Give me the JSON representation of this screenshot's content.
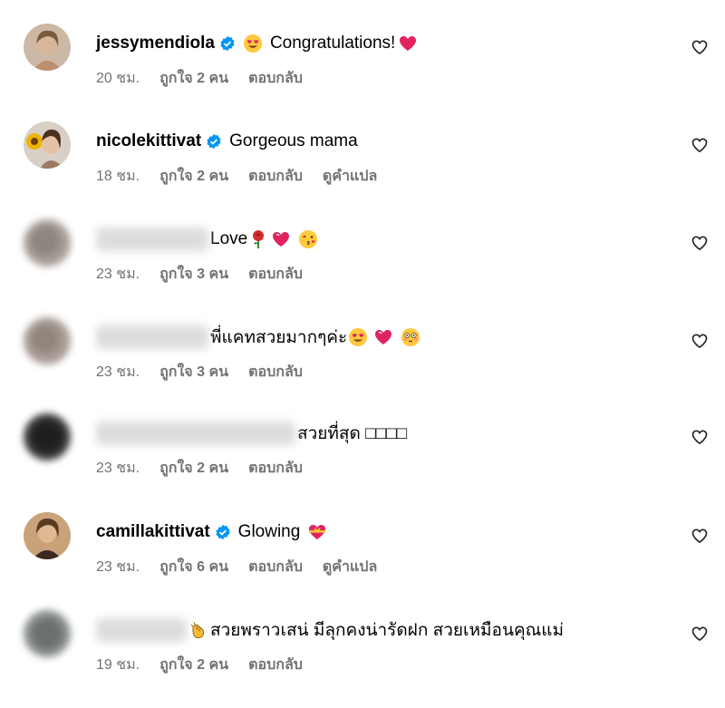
{
  "comments": [
    {
      "username": "jessymendiola",
      "verified": true,
      "text": "Congratulations!",
      "time": "20 ชม.",
      "likes": "ถูกใจ 2 คน",
      "reply": "ตอบกลับ",
      "translate": ""
    },
    {
      "username": "nicolekittivat",
      "verified": true,
      "text": "Gorgeous mama",
      "time": "18 ชม.",
      "likes": "ถูกใจ 2 คน",
      "reply": "ตอบกลับ",
      "translate": "ดูคำแปล"
    },
    {
      "username": "",
      "verified": false,
      "text": "Love",
      "time": "23 ชม.",
      "likes": "ถูกใจ 3 คน",
      "reply": "ตอบกลับ",
      "translate": ""
    },
    {
      "username": "",
      "verified": false,
      "text": "พี่แคทสวยมากๆค่ะ",
      "time": "23 ชม.",
      "likes": "ถูกใจ 3 คน",
      "reply": "ตอบกลับ",
      "translate": ""
    },
    {
      "username": "",
      "verified": false,
      "text": "สวยที่สุด □□□□",
      "time": "23 ชม.",
      "likes": "ถูกใจ 2 คน",
      "reply": "ตอบกลับ",
      "translate": ""
    },
    {
      "username": "camillakittivat",
      "verified": true,
      "text": "Glowing",
      "time": "23 ชม.",
      "likes": "ถูกใจ 6 คน",
      "reply": "ตอบกลับ",
      "translate": "ดูคำแปล"
    },
    {
      "username": "",
      "verified": false,
      "text": "สวยพราวเสน่ มีลุกคงน่ารัดฝก สวยเหมือนคุณแม่",
      "time": "19 ชม.",
      "likes": "ถูกใจ 2 คน",
      "reply": "ตอบกลับ",
      "translate": ""
    }
  ],
  "icons": {
    "verified_badge": "verified-badge-icon",
    "like": "heart-outline-icon"
  },
  "colors": {
    "verified_blue": "#0095f6",
    "meta_gray": "#737373",
    "emoji_heart_red": "#e0245e"
  }
}
